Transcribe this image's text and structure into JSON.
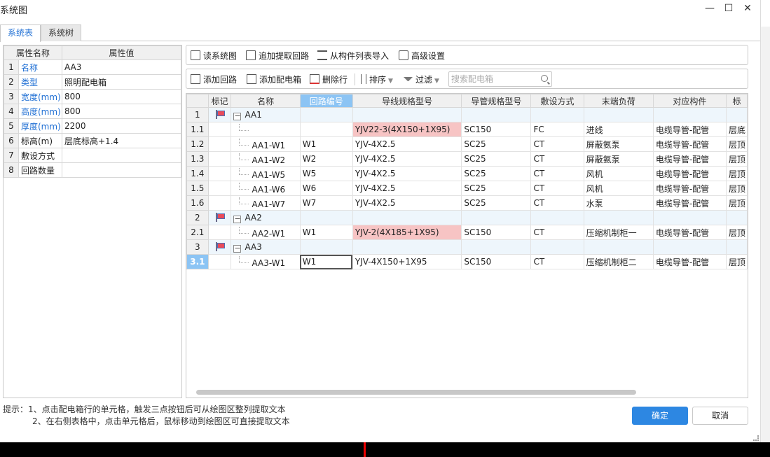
{
  "window": {
    "title": "系统图",
    "minimize_glyph": "—",
    "maximize_glyph": "☐",
    "close_glyph": "✕"
  },
  "tabs": [
    {
      "label": "系统表",
      "active": true
    },
    {
      "label": "系统树",
      "active": false
    }
  ],
  "props": {
    "headers": [
      "属性名称",
      "属性值"
    ],
    "rows": [
      {
        "idx": "1",
        "key": "名称",
        "value": "AA3",
        "link": true
      },
      {
        "idx": "2",
        "key": "类型",
        "value": "照明配电箱",
        "link": true
      },
      {
        "idx": "3",
        "key": "宽度(mm)",
        "value": "800",
        "link": true
      },
      {
        "idx": "4",
        "key": "高度(mm)",
        "value": "800",
        "link": true
      },
      {
        "idx": "5",
        "key": "厚度(mm)",
        "value": "2200",
        "link": true
      },
      {
        "idx": "6",
        "key": "标高(m)",
        "value": "层底标高+1.4",
        "link": false
      },
      {
        "idx": "7",
        "key": "敷设方式",
        "value": "",
        "link": false
      },
      {
        "idx": "8",
        "key": "回路数量",
        "value": "",
        "link": false
      }
    ]
  },
  "toolbar1": {
    "read": "读系统图",
    "append": "追加提取回路",
    "import": "从构件列表导入",
    "advanced": "高级设置"
  },
  "toolbar2": {
    "add_circuit": "添加回路",
    "add_box": "添加配电箱",
    "delete": "删除行",
    "sort": "排序",
    "filter": "过滤",
    "search_placeholder": "搜索配电箱"
  },
  "grid": {
    "columns": [
      "",
      "标记",
      "名称",
      "回路编号",
      "导线规格型号",
      "导管规格型号",
      "敷设方式",
      "末端负荷",
      "对应构件",
      "标"
    ],
    "selected_column": "回路编号",
    "rows": [
      {
        "rn": "1",
        "group": true,
        "name": "AA1"
      },
      {
        "rn": "1.1",
        "name": "",
        "circuit": "",
        "wire": "YJV22-3(4X150+1X95)",
        "wire_error": true,
        "conduit": "SC150",
        "method": "FC",
        "load": "进线",
        "comp": "电缆导管-配管",
        "elev": "层底"
      },
      {
        "rn": "1.2",
        "name": "AA1-W1",
        "circuit": "W1",
        "wire": "YJV-4X2.5",
        "conduit": "SC25",
        "method": "CT",
        "load": "屏蔽氨泵",
        "comp": "电缆导管-配管",
        "elev": "层顶"
      },
      {
        "rn": "1.3",
        "name": "AA1-W2",
        "circuit": "W2",
        "wire": "YJV-4X2.5",
        "conduit": "SC25",
        "method": "CT",
        "load": "屏蔽氨泵",
        "comp": "电缆导管-配管",
        "elev": "层顶"
      },
      {
        "rn": "1.4",
        "name": "AA1-W5",
        "circuit": "W5",
        "wire": "YJV-4X2.5",
        "conduit": "SC25",
        "method": "CT",
        "load": "风机",
        "comp": "电缆导管-配管",
        "elev": "层顶"
      },
      {
        "rn": "1.5",
        "name": "AA1-W6",
        "circuit": "W6",
        "wire": "YJV-4X2.5",
        "conduit": "SC25",
        "method": "CT",
        "load": "风机",
        "comp": "电缆导管-配管",
        "elev": "层顶"
      },
      {
        "rn": "1.6",
        "name": "AA1-W7",
        "circuit": "W7",
        "wire": "YJV-4X2.5",
        "conduit": "SC25",
        "method": "CT",
        "load": "水泵",
        "comp": "电缆导管-配管",
        "elev": "层顶"
      },
      {
        "rn": "2",
        "group": true,
        "name": "AA2"
      },
      {
        "rn": "2.1",
        "name": "AA2-W1",
        "circuit": "W1",
        "wire": "YJV-2(4X185+1X95)",
        "wire_error": true,
        "conduit": "SC150",
        "method": "CT",
        "load": "压缩机制柜一",
        "comp": "电缆导管-配管",
        "elev": "层顶"
      },
      {
        "rn": "3",
        "group": true,
        "name": "AA3"
      },
      {
        "rn": "3.1",
        "name": "AA3-W1",
        "circuit": "W1",
        "wire": "YJV-4X150+1X95",
        "conduit": "SC150",
        "method": "CT",
        "load": "压缩机制柜二",
        "comp": "电缆导管-配管",
        "elev": "层顶",
        "active": true
      }
    ]
  },
  "hint": {
    "label": "提示：",
    "line1": "1、点击配电箱行的单元格，触发三点按钮后可从绘图区整列提取文本",
    "line2": "2、在右侧表格中，点击单元格后，鼠标移动到绘图区可直接提取文本"
  },
  "buttons": {
    "ok": "确定",
    "cancel": "取消"
  },
  "colors": {
    "accent": "#2d87e2",
    "error_cell": "#f7c4c4",
    "selected_header": "#8cc4f4"
  }
}
